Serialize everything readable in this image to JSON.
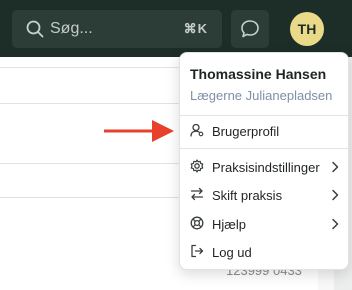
{
  "header": {
    "search_placeholder": "Søg...",
    "search_shortcut": "⌘K",
    "avatar_initials": "TH"
  },
  "background": {
    "partial_number": "123999 0433"
  },
  "user_menu": {
    "user_name": "Thomassine Hansen",
    "clinic_name": "Lægerne Julianepladsen",
    "items": [
      {
        "label": "Brugerprofil",
        "icon": "user-icon",
        "has_submenu": false
      },
      {
        "label": "Praksisindstillinger",
        "icon": "gear-icon",
        "has_submenu": true
      },
      {
        "label": "Skift praksis",
        "icon": "switch-arrows-icon",
        "has_submenu": true
      },
      {
        "label": "Hjælp",
        "icon": "lifebuoy-icon",
        "has_submenu": true
      },
      {
        "label": "Log ud",
        "icon": "logout-icon",
        "has_submenu": false
      }
    ]
  },
  "colors": {
    "header_bg": "#1d2e28",
    "avatar_bg": "#ebd98a",
    "annotation_arrow": "#e8402a",
    "clinic_text": "#7e8fa6"
  }
}
